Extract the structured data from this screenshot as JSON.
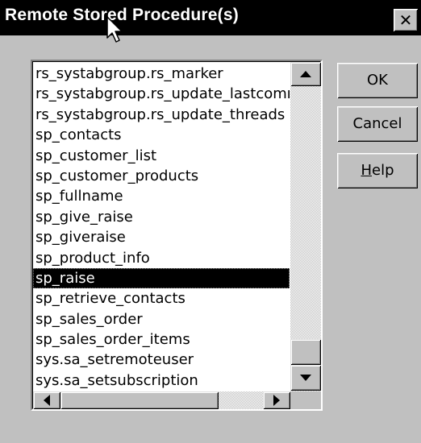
{
  "window": {
    "title": "Remote Stored Procedure(s)",
    "close_glyph": "✕"
  },
  "procedures": {
    "items": [
      "rs_systabgroup.rs_marker",
      "rs_systabgroup.rs_update_lastcommit",
      "rs_systabgroup.rs_update_threads",
      "sp_contacts",
      "sp_customer_list",
      "sp_customer_products",
      "sp_fullname",
      "sp_give_raise",
      "sp_giveraise",
      "sp_product_info",
      "sp_raise",
      "sp_retrieve_contacts",
      "sp_sales_order",
      "sp_sales_order_items",
      "sys.sa_setremoteuser",
      "sys.sa_setsubscription"
    ],
    "selected_index": 10
  },
  "buttons": {
    "ok_label": "OK",
    "cancel_label": "Cancel",
    "help_mnemonic": "H",
    "help_rest": "elp"
  },
  "icons": {
    "close": "close-icon",
    "cursor": "mouse-pointer-icon",
    "scroll_up": "triangle-up-icon",
    "scroll_down": "triangle-down-icon",
    "scroll_left": "triangle-left-icon",
    "scroll_right": "triangle-right-icon"
  },
  "colors": {
    "titlebar": "#000000",
    "face": "#c0c0c0",
    "selection": "#000000"
  }
}
